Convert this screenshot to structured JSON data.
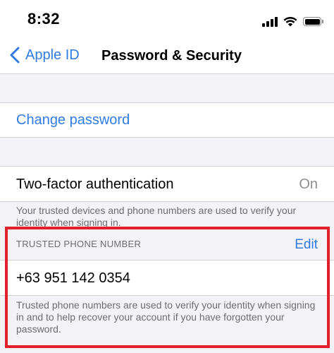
{
  "status_bar": {
    "time": "8:32"
  },
  "nav": {
    "back_label": "Apple ID",
    "title": "Password & Security"
  },
  "change_password": {
    "label": "Change password"
  },
  "two_factor": {
    "label": "Two-factor authentication",
    "value": "On",
    "footer": "Your trusted devices and phone numbers are used to verify your identity when signing in."
  },
  "trusted_phone": {
    "header": "TRUSTED PHONE NUMBER",
    "edit_label": "Edit",
    "number": "+63 951 142 0354",
    "footer": "Trusted phone numbers are used to verify your identity when signing in and to help recover your account if you have forgotten your password."
  },
  "colors": {
    "accent": "#2f7be0",
    "background": "#f2f2f7",
    "secondary_text": "#6d6d72",
    "annotation": "#e0202a"
  },
  "icons": {
    "back": "chevron-left-icon",
    "signal": "cellular-signal-icon",
    "wifi": "wifi-icon",
    "battery": "battery-icon"
  }
}
